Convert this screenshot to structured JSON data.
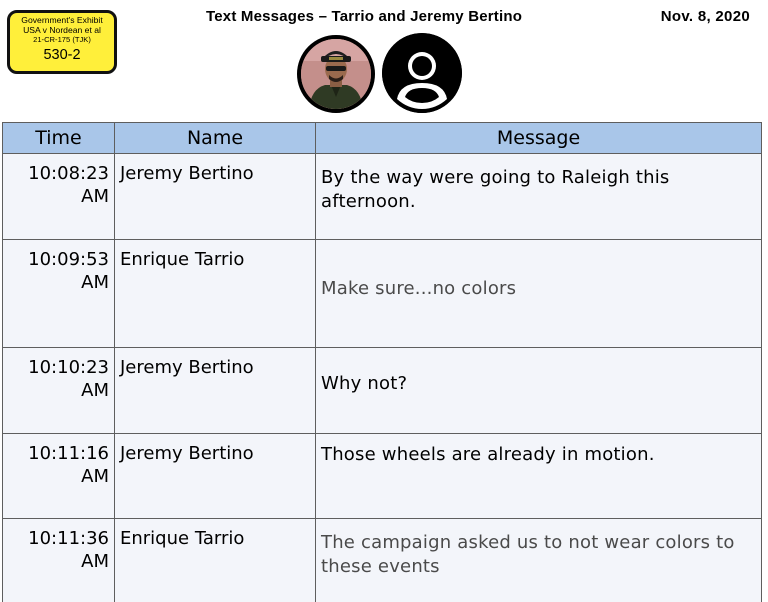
{
  "exhibit": {
    "line1": "Government's Exhibit",
    "line2": "USA v Nordean et al",
    "line3": "21-CR-175 (TJK)",
    "number": "530-2"
  },
  "header": {
    "title": "Text Messages – Tarrio and Jeremy Bertino",
    "date": "Nov. 8, 2020"
  },
  "avatars": {
    "left": "person-photo",
    "right": "generic-user-icon"
  },
  "table": {
    "columns": [
      "Time",
      "Name",
      "Message"
    ],
    "rows": [
      {
        "time_1": "10:08:23",
        "time_2": "AM",
        "name": "Jeremy Bertino",
        "message": "By the way were going to Raleigh this afternoon."
      },
      {
        "time_1": "10:09:53",
        "time_2": "AM",
        "name": "Enrique Tarrio",
        "message": "Make sure...no colors"
      },
      {
        "time_1": "10:10:23",
        "time_2": "AM",
        "name": "Jeremy Bertino",
        "message": "Why not?"
      },
      {
        "time_1": "10:11:16",
        "time_2": "AM",
        "name": "Jeremy Bertino",
        "message": "Those wheels are already in motion."
      },
      {
        "time_1": "10:11:36",
        "time_2": "AM",
        "name": "Enrique Tarrio",
        "message": "The campaign asked us to not wear colors to these events"
      }
    ]
  },
  "colors": {
    "header_fill": "#a9c6e9",
    "row_fill": "#f3f5fa",
    "exhibit_fill": "#ffef3a",
    "dim_text": "#4a4a4a"
  }
}
